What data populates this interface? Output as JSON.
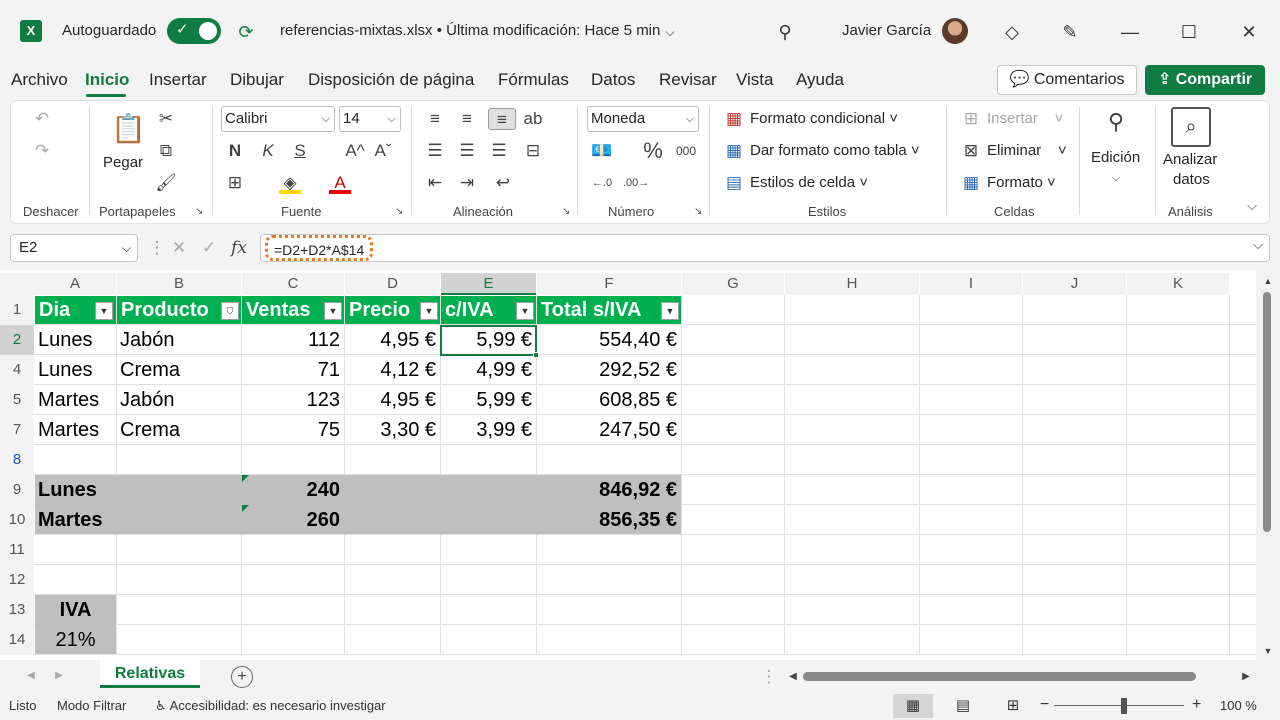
{
  "titlebar": {
    "autosave_label": "Autoguardado",
    "file_title": "referencias-mixtas.xlsx • Última modificación: Hace 5 min",
    "user_name": "Javier García",
    "logo_letter": "X"
  },
  "menu": {
    "tabs": [
      "Archivo",
      "Inicio",
      "Insertar",
      "Dibujar",
      "Disposición de página",
      "Fórmulas",
      "Datos",
      "Revisar",
      "Vista",
      "Ayuda"
    ],
    "comments_label": "Comentarios",
    "share_label": "Compartir"
  },
  "ribbon": {
    "groups": {
      "undo": "Deshacer",
      "clipboard": "Portapapeles",
      "font": "Fuente",
      "alignment": "Alineación",
      "number": "Número",
      "styles": "Estilos",
      "cells": "Celdas",
      "analysis": "Análisis"
    },
    "paste_label": "Pegar",
    "font_name": "Calibri",
    "font_size": "14",
    "bold": "N",
    "italic": "K",
    "underline": "S",
    "number_format": "Moneda",
    "percent": "%",
    "thousands": "000",
    "conditional_format": "Formato condicional",
    "format_as_table": "Dar formato como tabla",
    "cell_styles": "Estilos de celda",
    "insert": "Insertar",
    "delete": "Eliminar",
    "format": "Formato",
    "editing": "Edición",
    "analyze_line1": "Analizar",
    "analyze_line2": "datos"
  },
  "formula_bar": {
    "name_box": "E2",
    "formula": "=D2+D2*A$14",
    "fx": "fx"
  },
  "sheet": {
    "columns": [
      "A",
      "B",
      "C",
      "D",
      "E",
      "F",
      "G",
      "H",
      "I",
      "J",
      "K"
    ],
    "rows": [
      "1",
      "2",
      "4",
      "5",
      "7",
      "8",
      "9",
      "10",
      "11",
      "12",
      "13",
      "14"
    ],
    "headers": [
      "Dia",
      "Producto",
      "Ventas",
      "Precio",
      "c/IVA",
      "Total s/IVA"
    ],
    "data": [
      [
        "Lunes",
        "Jabón",
        "112",
        "4,95 €",
        "5,99 €",
        "554,40 €"
      ],
      [
        "Lunes",
        "Crema",
        "71",
        "4,12 €",
        "4,99 €",
        "292,52 €"
      ],
      [
        "Martes",
        "Jabón",
        "123",
        "4,95 €",
        "5,99 €",
        "608,85 €"
      ],
      [
        "Martes",
        "Crema",
        "75",
        "3,30 €",
        "3,99 €",
        "247,50 €"
      ]
    ],
    "summary": [
      [
        "Lunes",
        "240",
        "846,92 €"
      ],
      [
        "Martes",
        "260",
        "856,35 €"
      ]
    ],
    "iva_label": "IVA",
    "iva_value": "21%"
  },
  "sheet_tabs": {
    "active": "Relativas",
    "add": "+"
  },
  "statusbar": {
    "ready": "Listo",
    "filter_mode": "Modo Filtrar",
    "accessibility": "Accesibilidad: es necesario investigar",
    "zoom_minus": "−",
    "zoom_plus": "+",
    "zoom_level": "100 %"
  },
  "colors": {
    "accent": "#107c41",
    "table_header": "#00b050",
    "summary_band": "#bfbfbf",
    "formula_marquee": "#e97a1a"
  }
}
